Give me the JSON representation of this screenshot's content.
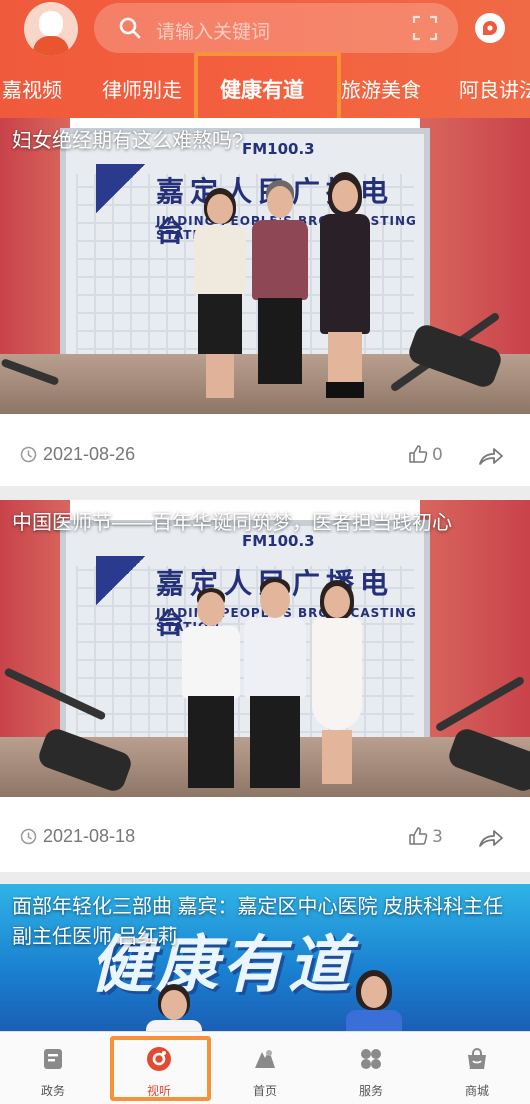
{
  "header": {
    "search_placeholder": "请输入关键词",
    "icons": {
      "avatar": "user-avatar",
      "search": "search-icon",
      "scan": "scan-icon",
      "message": "message-icon"
    }
  },
  "tabs": [
    {
      "label": "嘉视频"
    },
    {
      "label": "律师别走"
    },
    {
      "label": "健康有道",
      "active": true
    },
    {
      "label": "旅游美食"
    },
    {
      "label": "阿良讲法"
    }
  ],
  "feed": [
    {
      "caption": "妇女绝经期有这么难熬吗?",
      "date": "2021-08-26",
      "likes": "0",
      "studio_fm": "FM100.3",
      "studio_name": "嘉定人民广播电台",
      "studio_en": "JIADING PEOPLE'S BROADCASTING STATION"
    },
    {
      "caption": "中国医师节——百年华诞同筑梦，医者担当践初心",
      "date": "2021-08-18",
      "likes": "3",
      "studio_fm": "FM100.3",
      "studio_name": "嘉定人民广播电台",
      "studio_en": "JIADING PEOPLE'S BROADCASTING STATION"
    },
    {
      "caption": "面部年轻化三部曲 嘉宾：嘉定区中心医院 皮肤科科主任 副主任医师 吕红莉",
      "banner_title": "健康有道"
    }
  ],
  "bottom_nav": [
    {
      "label": "政务",
      "icon": "document-icon"
    },
    {
      "label": "视听",
      "icon": "play-icon",
      "active": true
    },
    {
      "label": "首页",
      "icon": "home-icon"
    },
    {
      "label": "服务",
      "icon": "grid-icon"
    },
    {
      "label": "商城",
      "icon": "shop-bag-icon"
    }
  ],
  "colors": {
    "brand": "#f05a3c",
    "highlight": "#f6923a",
    "active_nav": "#e24a32"
  }
}
